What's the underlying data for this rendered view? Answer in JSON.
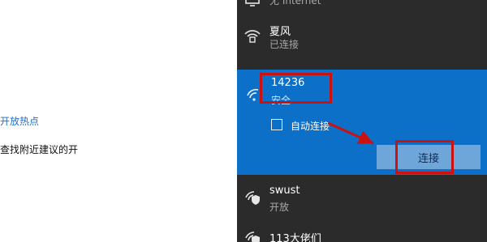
{
  "left_page": {
    "hotspot_link": "开放热点",
    "nearby_text": "查找附近建议的开"
  },
  "flyout": {
    "top_status": "无 Internet",
    "networks": [
      {
        "name": "夏风",
        "status": "已连接",
        "icon": "wifi-locked-icon"
      },
      {
        "name": "14236",
        "status": "安全",
        "icon": "wifi-icon",
        "selected": true
      },
      {
        "name": "swust",
        "status": "开放",
        "icon": "wifi-shield-icon"
      },
      {
        "name": "113大佬们",
        "status": "",
        "icon": "wifi-shield-icon"
      }
    ],
    "auto_connect_label": "自动连接",
    "auto_connect_checked": false,
    "connect_button": "连接"
  },
  "annotation_color": "#cc1111"
}
